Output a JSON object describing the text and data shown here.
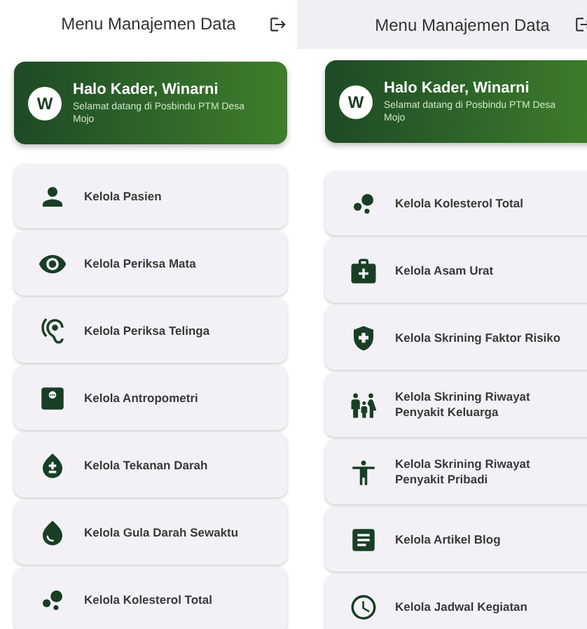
{
  "panels": [
    {
      "header": {
        "title": "Menu Manajemen Data",
        "scrolled": false
      },
      "greeting": {
        "avatar": "W",
        "title": "Halo Kader, Winarni",
        "subtitle": "Selamat datang di Posbindu PTM Desa Mojo"
      },
      "items": [
        {
          "kind": "person",
          "label": "Kelola Pasien"
        },
        {
          "kind": "eye",
          "label": "Kelola Periksa Mata"
        },
        {
          "kind": "ear",
          "label": "Kelola Periksa Telinga"
        },
        {
          "kind": "scale",
          "label": "Kelola Antropometri"
        },
        {
          "kind": "blood",
          "label": "Kelola Tekanan Darah"
        },
        {
          "kind": "drop",
          "label": "Kelola Gula Darah Sewaktu"
        },
        {
          "kind": "dots",
          "label": "Kelola Kolesterol Total"
        }
      ]
    },
    {
      "header": {
        "title": "Menu Manajemen Data",
        "scrolled": true
      },
      "greeting": {
        "avatar": "W",
        "title": "Halo Kader, Winarni",
        "subtitle": "Selamat datang di Posbindu PTM Desa Mojo"
      },
      "items": [
        {
          "kind": "dots",
          "label": "Kelola Kolesterol Total"
        },
        {
          "kind": "kit",
          "label": "Kelola Asam Urat"
        },
        {
          "kind": "shield",
          "label": "Kelola Skrining Faktor Risiko"
        },
        {
          "kind": "family",
          "label": "Kelola Skrining Riwayat Penyakit Keluarga"
        },
        {
          "kind": "standing",
          "label": "Kelola Skrining Riwayat Penyakit Pribadi"
        },
        {
          "kind": "article",
          "label": "Kelola Artikel Blog"
        },
        {
          "kind": "clock",
          "label": "Kelola Jadwal Kegiatan"
        }
      ]
    }
  ]
}
